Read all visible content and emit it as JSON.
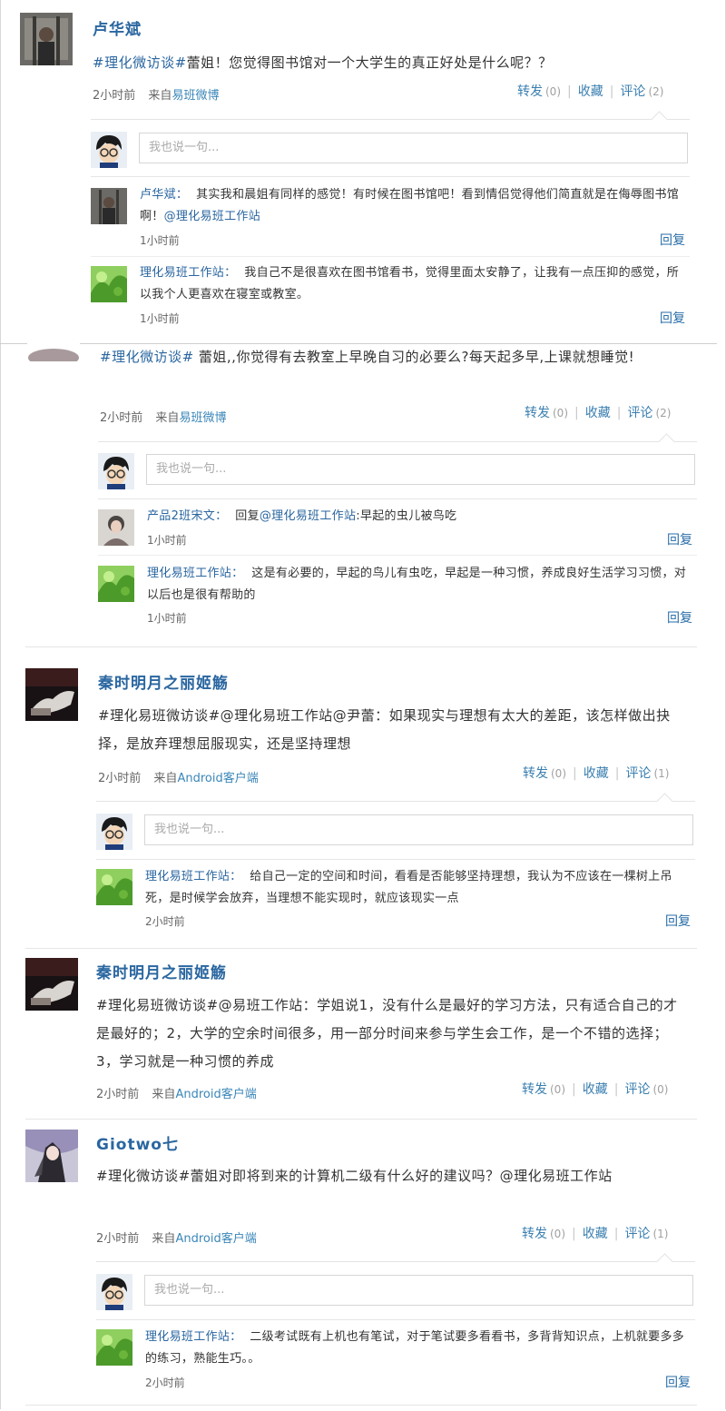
{
  "input_placeholder": "我也说一句...",
  "actions": {
    "forward": "转发",
    "favorite": "收藏",
    "comment": "评论"
  },
  "reply_label": "回复",
  "source_prefix": "来自",
  "posts": [
    {
      "author": "卢华斌",
      "topic": "#理化微访谈#",
      "text": "蕾姐！您觉得图书馆对一个大学生的真正好处是什么呢？？",
      "time": "2小时前",
      "source": "易班微博",
      "forward_count": "(0)",
      "comment_count": "(2)",
      "replies": [
        {
          "name": "卢华斌：",
          "text": "其实我和晨姐有同样的感觉！有时候在图书馆吧！看到情侣觉得他们简直就是在侮辱图书馆啊！",
          "at": "@理化易班工作站",
          "time": "1小时前"
        },
        {
          "name": "理化易班工作站：",
          "text": "我自己不是很喜欢在图书馆看书，觉得里面太安静了，让我有一点压抑的感觉，所以我个人更喜欢在寝室或教室。",
          "time": "1小时前"
        }
      ]
    },
    {
      "author": "",
      "topic": "#理化微访谈#",
      "text": " 蕾姐,,你觉得有去教室上早晚自习的必要么?每天起多早,上课就想睡觉!",
      "time": "2小时前",
      "source": "易班微博",
      "forward_count": "(0)",
      "comment_count": "(2)",
      "replies": [
        {
          "name": "产品2班宋文：",
          "text": "回复",
          "at": "@理化易班工作站",
          "text2": ":早起的虫儿被鸟吃",
          "time": "1小时前"
        },
        {
          "name": "理化易班工作站：",
          "text": "这是有必要的，早起的鸟儿有虫吃，早起是一种习惯，养成良好生活学习习惯，对以后也是很有帮助的",
          "time": "1小时前"
        }
      ]
    },
    {
      "author": "秦时明月之丽姬觞",
      "topic": "",
      "text": "#理化易班微访谈#@理化易班工作站@尹蕾：如果现实与理想有太大的差距，该怎样做出抉择，是放弃理想屈服现实，还是坚持理想",
      "time": "2小时前",
      "source": "Android客户端",
      "forward_count": "(0)",
      "comment_count": "(1)",
      "replies": [
        {
          "name": "理化易班工作站：",
          "text": "给自己一定的空间和时间，看看是否能够坚持理想，我认为不应该在一棵树上吊死，是时候学会放弃，当理想不能实现时，就应该现实一点",
          "time": "2小时前"
        }
      ]
    },
    {
      "author": "秦时明月之丽姬觞",
      "topic": "",
      "text": "#理化易班微访谈#@易班工作站：学姐说1，没有什么是最好的学习方法，只有适合自己的才是最好的；2，大学的空余时间很多，用一部分时间来参与学生会工作，是一个不错的选择；3，学习就是一种习惯的养成",
      "time": "2小时前",
      "source": "Android客户端",
      "forward_count": "(0)",
      "comment_count": "(0)",
      "replies": []
    },
    {
      "author": "Giotwo七",
      "topic": "",
      "text": "#理化微访谈#蕾姐对即将到来的计算机二级有什么好的建议吗？@理化易班工作站",
      "time": "2小时前",
      "source": "Android客户端",
      "forward_count": "(0)",
      "comment_count": "(1)",
      "replies": [
        {
          "name": "理化易班工作站：",
          "text": "二级考试既有上机也有笔试，对于笔试要多看看书，多背背知识点，上机就要多多的练习，熟能生巧。。",
          "time": "2小时前"
        }
      ]
    }
  ]
}
